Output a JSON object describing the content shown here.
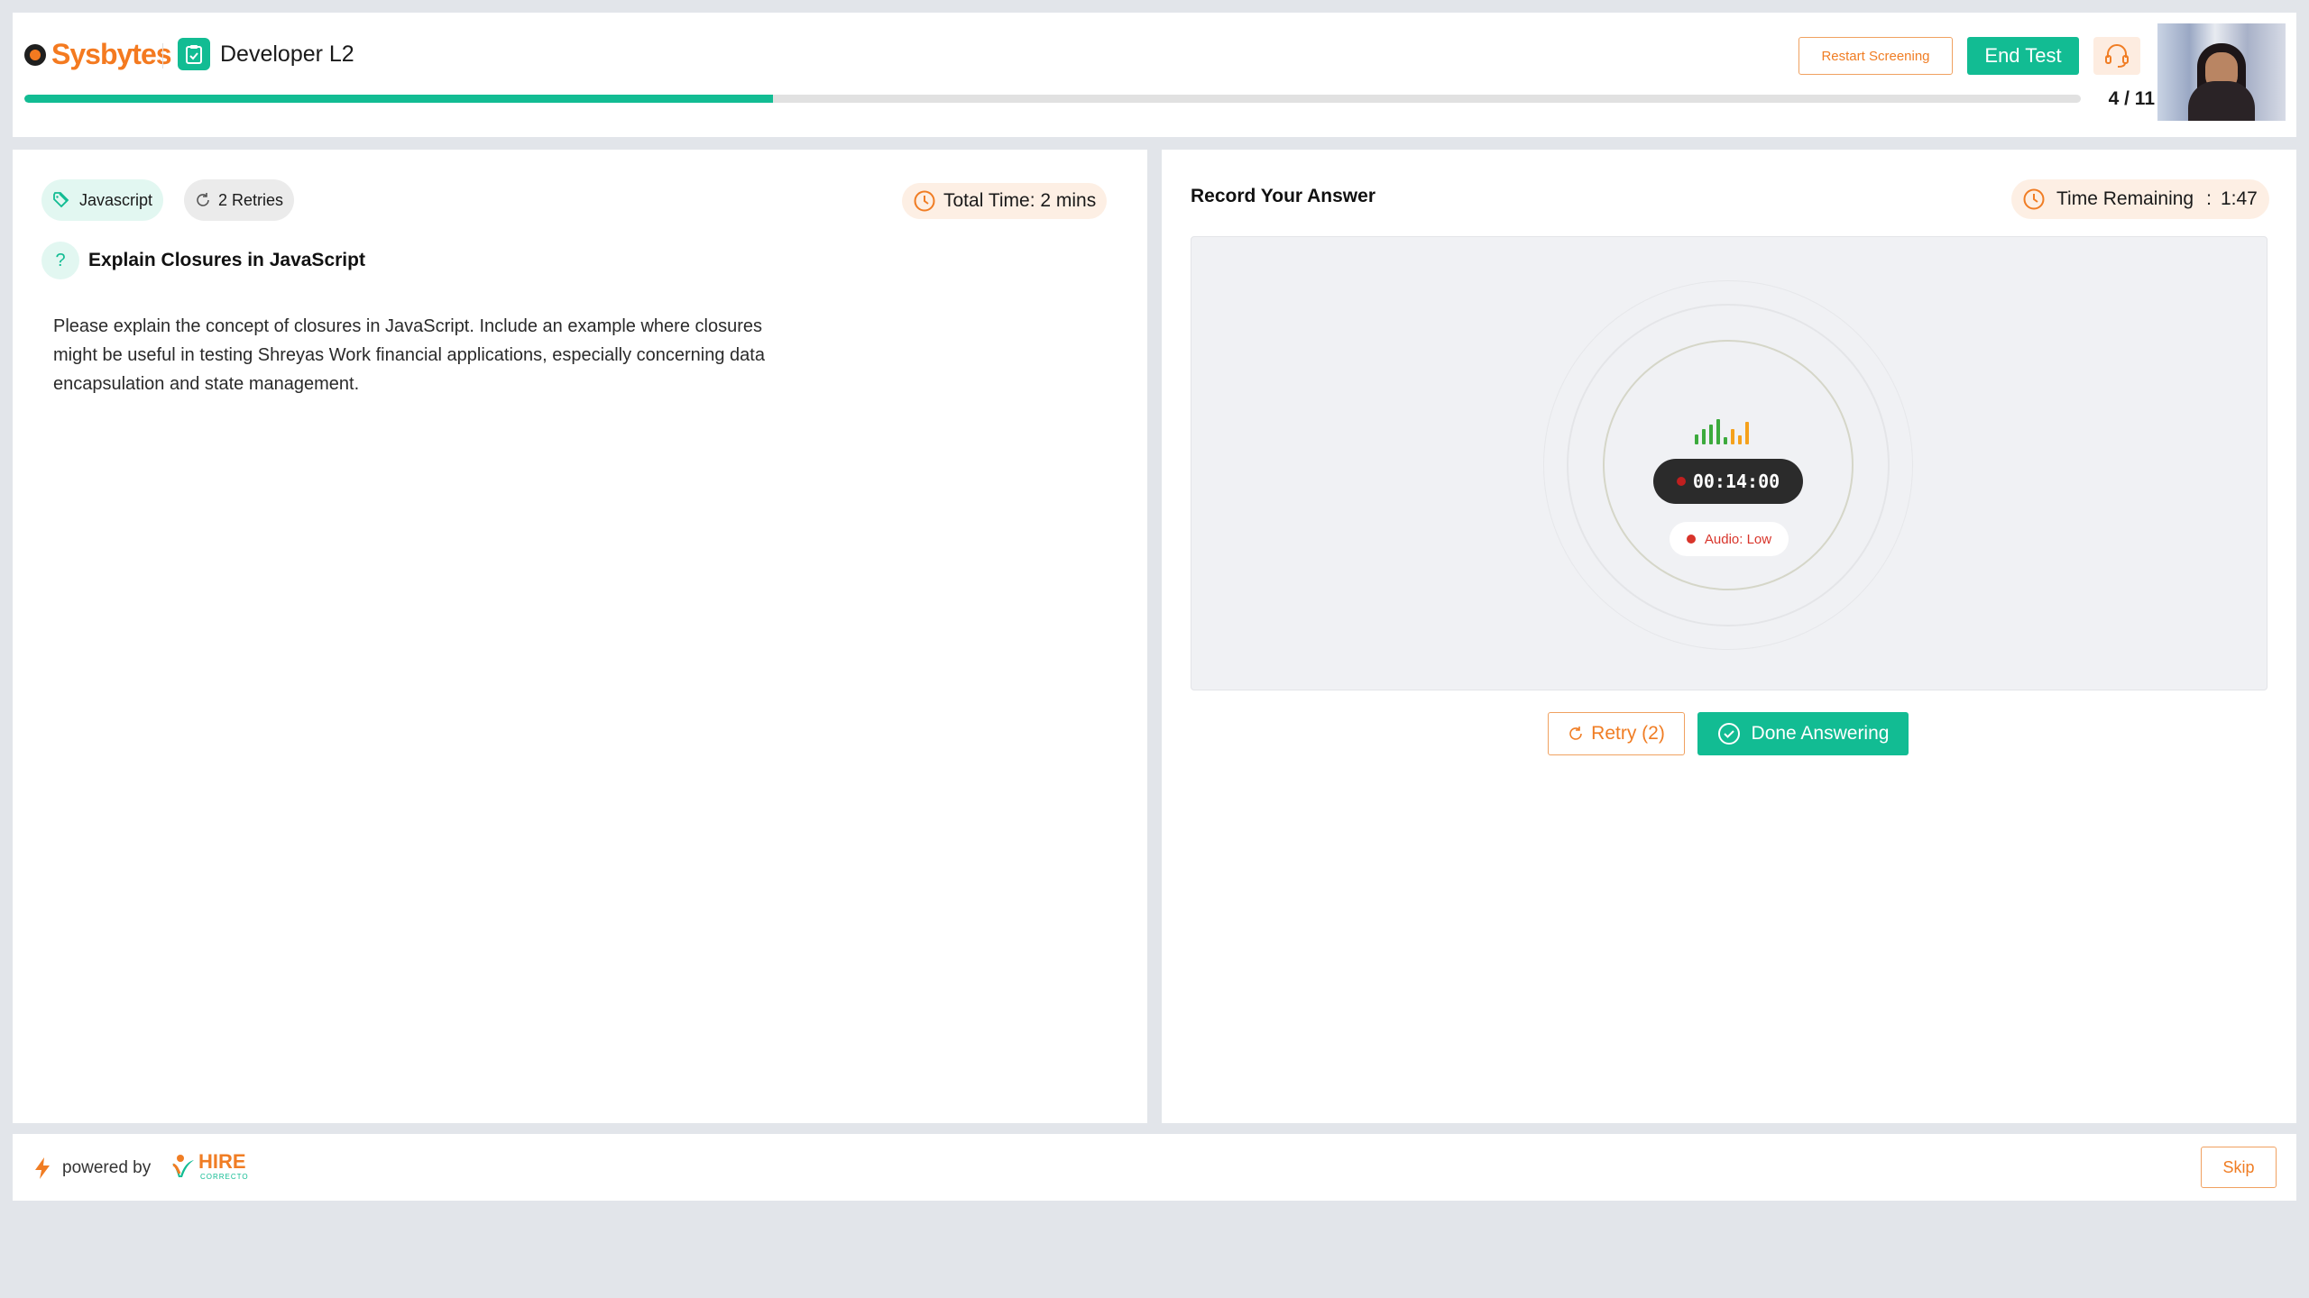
{
  "header": {
    "brand": "Sysbytes",
    "title": "Developer L2",
    "restart_label": "Restart Screening",
    "end_label": "End Test",
    "progress": {
      "current": 4,
      "total": 11,
      "label": "4 / 11",
      "fraction": 0.364
    }
  },
  "question": {
    "tag": "Javascript",
    "retries": "2 Retries",
    "total_time": "Total Time: 2 mins",
    "title": "Explain Closures in JavaScript",
    "body": "Please explain the concept of closures in JavaScript. Include an example where closures might be useful in testing Shreyas Work financial applications, especially concerning data encapsulation and state management."
  },
  "answer": {
    "title": "Record Your Answer",
    "time_remaining_label": "Time Remaining",
    "time_remaining_value": "1:47",
    "timer": "00:14:00",
    "audio_status": "Audio: Low",
    "retry_label": "Retry (2)",
    "done_label": "Done Answering",
    "level_bars": [
      {
        "level": 0.4,
        "color": "#3caa3c"
      },
      {
        "level": 0.6,
        "color": "#3caa3c"
      },
      {
        "level": 0.8,
        "color": "#3caa3c"
      },
      {
        "level": 1.0,
        "color": "#3caa3c"
      },
      {
        "level": 0.3,
        "color": "#3caa3c"
      },
      {
        "level": 0.6,
        "color": "#f5a11c"
      },
      {
        "level": 0.35,
        "color": "#f5a11c"
      },
      {
        "level": 0.9,
        "color": "#f5a11c"
      }
    ]
  },
  "footer": {
    "powered_by": "powered by",
    "hire_brand": "HIRE",
    "hire_sub": "CORRECTO",
    "skip_label": "Skip"
  },
  "colors": {
    "accent_green": "#12bc93",
    "accent_orange": "#f07d24",
    "recording_red": "#c01f1f"
  },
  "icons": [
    "clipboard-icon",
    "headset-icon",
    "tag-icon",
    "retry-icon",
    "clock-icon",
    "question-icon",
    "check-circle-icon",
    "bolt-icon"
  ]
}
